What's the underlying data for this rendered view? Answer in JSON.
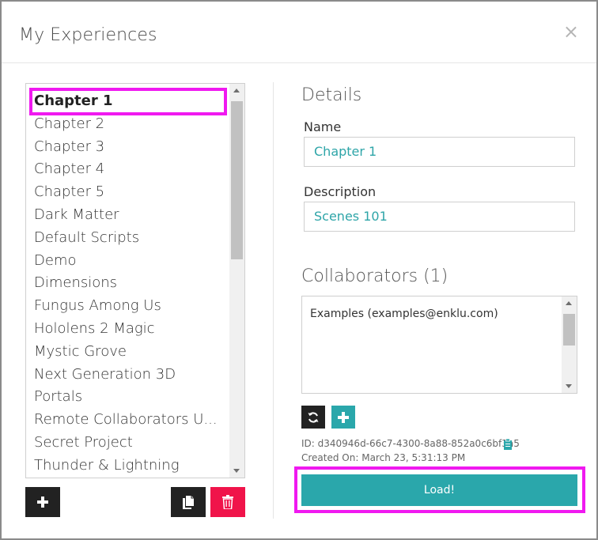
{
  "dialog": {
    "title": "My Experiences",
    "close_glyph": "×"
  },
  "experiences": {
    "selected_index": 0,
    "items": [
      {
        "label": "Chapter 1"
      },
      {
        "label": "Chapter 2"
      },
      {
        "label": "Chapter 3"
      },
      {
        "label": "Chapter 4"
      },
      {
        "label": "Chapter 5"
      },
      {
        "label": "Dark Matter"
      },
      {
        "label": "Default Scripts"
      },
      {
        "label": "Demo"
      },
      {
        "label": "Dimensions"
      },
      {
        "label": "Fungus Among Us"
      },
      {
        "label": "Hololens 2 Magic"
      },
      {
        "label": "Mystic Grove"
      },
      {
        "label": "Next Generation 3D"
      },
      {
        "label": "Portals"
      },
      {
        "label": "Remote Collaborators U..."
      },
      {
        "label": "Secret Project"
      },
      {
        "label": "Thunder & Lightning"
      }
    ]
  },
  "list_actions": {
    "add_icon": "plus-icon",
    "duplicate_icon": "copy-icon",
    "delete_icon": "trash-icon"
  },
  "details": {
    "heading": "Details",
    "name_label": "Name",
    "name_value": "Chapter 1",
    "description_label": "Description",
    "description_value": "Scenes 101"
  },
  "collaborators": {
    "heading": "Collaborators (1)",
    "items": [
      {
        "label": "Examples (examples@enklu.com)"
      }
    ],
    "refresh_icon": "refresh-icon",
    "add_icon": "plus-icon"
  },
  "meta": {
    "id_text": "ID: d340946d-66c7-4300-8a88-852a0c6bf3a5",
    "copy_icon": "clipboard-icon",
    "created_text": "Created On: March 23, 5:31:13 PM"
  },
  "load_button": {
    "label": "Load!"
  },
  "colors": {
    "teal": "#2aa7ab",
    "teal_text": "#2ea5a8",
    "red": "#f0144a",
    "highlight": "#f019f0",
    "dark": "#222222"
  }
}
